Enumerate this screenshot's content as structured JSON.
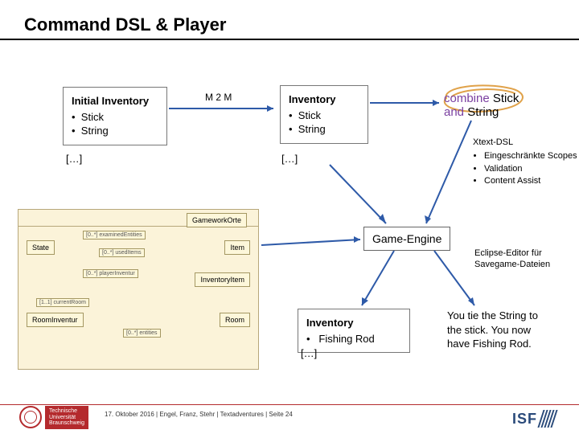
{
  "title": "Command DSL & Player",
  "box_initial": {
    "heading": "Initial Inventory",
    "items": [
      "Stick",
      "String"
    ]
  },
  "box_inv1": {
    "heading": "Inventory",
    "items": [
      "Stick",
      "String"
    ]
  },
  "box_inv2": {
    "heading": "Inventory",
    "items": [
      "Fishing Rod"
    ]
  },
  "ellipsis": "[…]",
  "m2m_label": "M 2 M",
  "combine": {
    "kw1": "combine",
    "a": "Stick",
    "kw2": "and",
    "b": "String"
  },
  "xtext": {
    "title": "Xtext-DSL",
    "items": [
      "Eingeschränkte Scopes",
      "Validation",
      "Content Assist"
    ]
  },
  "game_engine": "Game-Engine",
  "eclipse_note": "Eclipse-Editor für Savegame-Dateien",
  "result_text": "You tie the String to the stick. You now have Fishing Rod.",
  "uml": {
    "classes": [
      "State",
      "Item",
      "RoomInventur",
      "Room",
      "GameworkOrte",
      "InventoryItem"
    ],
    "assocs": [
      "[0..*] examinedEntities",
      "[0..*] usedItems",
      "[0..*] playerInventur",
      "[1..1] currentRoom",
      "[0..*] entities"
    ]
  },
  "footer": "17. Oktober 2016 | Engel, Franz, Stehr | Textadventures | Seite 24",
  "tu_name": "Technische Universität Braunschweig",
  "isf": "ISF"
}
